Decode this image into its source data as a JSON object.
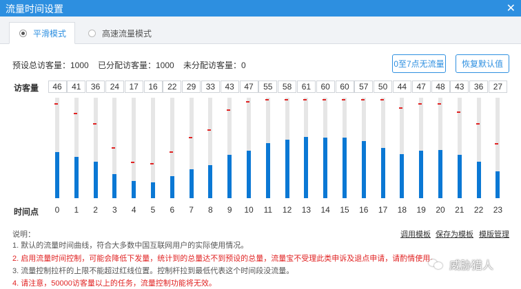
{
  "window": {
    "title": "流量时间设置",
    "close_glyph": "✕"
  },
  "tabs": [
    {
      "label": "平滑模式",
      "selected": true
    },
    {
      "label": "高速流量模式",
      "selected": false
    }
  ],
  "stats": {
    "preset_total": "预设总访客量：1000",
    "allocated": "已分配访客量：1000",
    "unallocated": "未分配访客量：0"
  },
  "buttons": {
    "no_traffic": "0至7点无流量",
    "restore_default": "恢复默认值"
  },
  "labels": {
    "visitors": "访客量",
    "time_point": "时间点"
  },
  "chart_data": {
    "type": "bar",
    "categories": [
      "0",
      "1",
      "2",
      "3",
      "4",
      "5",
      "6",
      "7",
      "8",
      "9",
      "10",
      "11",
      "12",
      "13",
      "14",
      "15",
      "16",
      "17",
      "18",
      "19",
      "20",
      "21",
      "22",
      "23"
    ],
    "values": [
      46,
      41,
      36,
      24,
      17,
      16,
      22,
      29,
      33,
      43,
      47,
      55,
      58,
      61,
      60,
      60,
      57,
      50,
      44,
      47,
      48,
      43,
      36,
      27
    ],
    "upper_limits": [
      96,
      86,
      76,
      52,
      38,
      36,
      48,
      62,
      70,
      90,
      98,
      100,
      100,
      100,
      100,
      100,
      100,
      100,
      92,
      96,
      96,
      88,
      76,
      56
    ],
    "ylim": [
      0,
      100
    ],
    "colors": {
      "fill": "#0b78d4",
      "track": "#e6e6e6",
      "limit": "#e02222"
    }
  },
  "notes": {
    "title": "说明：",
    "items": [
      {
        "text": "1. 默认的流量时间曲线，符合大多数中国互联网用户的实际使用情况。",
        "color": "gray"
      },
      {
        "text": "2. 启用流量时间控制，可能会降低下发量，统计到的总量达不到预设的总量，流量宝不受理此类申诉及退点申请，请酌情使用。",
        "color": "red"
      },
      {
        "text": "3. 流量控制拉杆的上限不能超过红线位置。控制杆拉到最低代表这个时间段没流量。",
        "color": "gray"
      },
      {
        "text": "4. 请注意，50000访客量以上的任务，流量控制功能将无效。",
        "color": "red"
      }
    ]
  },
  "template_links": {
    "use": "调用模板",
    "save": "保存为模板",
    "manage": "模版管理"
  },
  "watermark": {
    "text": "威胁猎人",
    "icon": "wechat-icon"
  }
}
